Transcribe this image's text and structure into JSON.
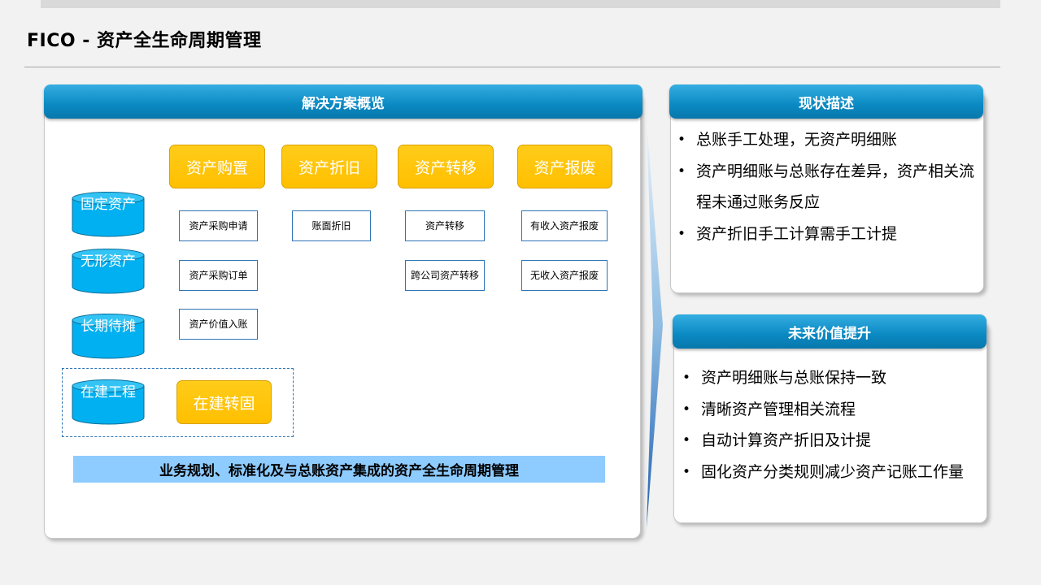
{
  "page": {
    "title": "FICO - 资产全生命周期管理"
  },
  "solution": {
    "header": "解决方案概览",
    "assets": [
      "固定资产",
      "无形资产",
      "长期待摊",
      "在建工程"
    ],
    "categories": [
      "资产购置",
      "资产折旧",
      "资产转移",
      "资产报废"
    ],
    "subitems": {
      "purchase": [
        "资产采购申请",
        "资产采购订单",
        "资产价值入账"
      ],
      "depreciation": [
        "账面折旧"
      ],
      "transfer": [
        "资产转移",
        "跨公司资产转移"
      ],
      "scrap": [
        "有收入资产报废",
        "无收入资产报废"
      ]
    },
    "cip_transfer": "在建转固",
    "banner": "业务规划、标准化及与总账资产集成的资产全生命周期管理"
  },
  "status": {
    "header": "现状描述",
    "items": [
      "总账手工处理，无资产明细账",
      "资产明细账与总账存在差异，资产相关流程未通过账务反应",
      "资产折旧手工计算需手工计提"
    ]
  },
  "future": {
    "header": "未来价值提升",
    "items": [
      "资产明细账与总账保持一致",
      "清晰资产管理相关流程",
      "自动计算资产折旧及计提",
      "固化资产分类规则减少资产记账工作量"
    ]
  },
  "colors": {
    "header_blue": "#0a89c2",
    "category_orange": "#ffc000",
    "cylinder_blue": "#00b0f0",
    "banner_blue": "#8ecbff",
    "sub_border": "#2f75b5"
  }
}
